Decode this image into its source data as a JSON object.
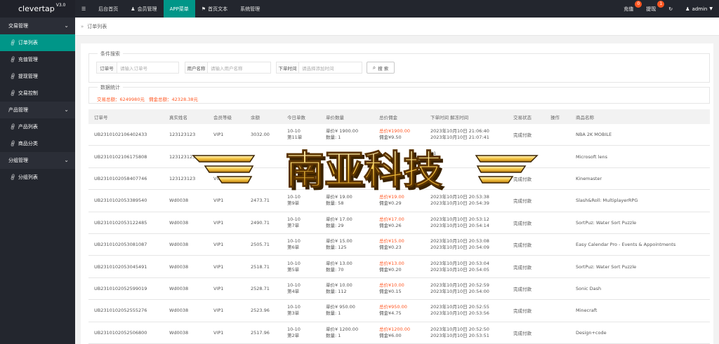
{
  "app": {
    "name": "clevertap",
    "version": "V3.0"
  },
  "topnav": [
    {
      "label": "后台首页",
      "icon": "home-icon",
      "glyph": "⌂"
    },
    {
      "label": "会员管理",
      "icon": "user-icon",
      "glyph": "♟"
    },
    {
      "label": "APP菜单",
      "icon": "",
      "glyph": "",
      "active": true
    },
    {
      "label": "首页文本",
      "icon": "flag-icon",
      "glyph": "⚑"
    },
    {
      "label": "系统管理",
      "icon": "",
      "glyph": ""
    }
  ],
  "topright": {
    "recharge": {
      "label": "充值",
      "badge": "0"
    },
    "withdraw": {
      "label": "提现",
      "badge": "1"
    },
    "refresh_glyph": "↻",
    "user": "admin"
  },
  "sidebar": [
    {
      "type": "group",
      "label": "交易管理"
    },
    {
      "type": "item",
      "label": "订单列表",
      "active": true
    },
    {
      "type": "item",
      "label": "充值管理"
    },
    {
      "type": "item",
      "label": "提现管理"
    },
    {
      "type": "item",
      "label": "交易控制"
    },
    {
      "type": "group",
      "label": "产品管理"
    },
    {
      "type": "item",
      "label": "产品列表"
    },
    {
      "type": "item",
      "label": "商品分类"
    },
    {
      "type": "group",
      "label": "分组管理"
    },
    {
      "type": "item",
      "label": "分组列表"
    }
  ],
  "breadcrumb": "订单列表",
  "search": {
    "legend": "条件搜索",
    "order_label": "订单号",
    "order_placeholder": "请输入订单号",
    "user_label": "用户名称",
    "user_placeholder": "请输入用户名称",
    "time_label": "下单时间",
    "time_placeholder": "请选择添加时间",
    "button": "搜 索"
  },
  "stats": {
    "legend": "数据统计",
    "total_trade": "交易总额：6249980元",
    "total_commission": "佣金总额：42328.38元"
  },
  "table": {
    "headers": [
      "订单号",
      "真实姓名",
      "会员等级",
      "余额",
      "今日单数",
      "单价数量",
      "总价佣金",
      "下单时间 解冻时间",
      "交易状态",
      "操作",
      "商品名称"
    ],
    "rows": [
      {
        "order": "UB2310102106402433",
        "name": "123123123",
        "level": "VIP1",
        "balance": "3032.00",
        "day": "10-10",
        "nth": "第11单",
        "price": "单价¥ 1900.00",
        "qty": "数量: 1",
        "total": "总价¥1900.00",
        "comm": "佣金¥9.50",
        "t1": "2023年10月10日 21:06:40",
        "t2": "2023年10月10日 21:07:41",
        "status": "完成付款",
        "product": "NBA 2K MOBILE"
      },
      {
        "order": "UB2310102106175808",
        "name": "123123123",
        "level": "",
        "balance": "",
        "day": "",
        "nth": "",
        "price": "",
        "qty": "",
        "total": "",
        "comm": "",
        "t1": "21",
        "t2": "21",
        "status": "完成付款",
        "product": "Microsoft lens"
      },
      {
        "order": "UB2310102058407746",
        "name": "123123123",
        "level": "VIP1",
        "balance": "",
        "day": "",
        "nth": "",
        "price": "",
        "qty": "",
        "total": "",
        "comm": "佣金¥10.0",
        "t1": "",
        "t2": ":42",
        "status": "完成付款",
        "product": "Kinemaster"
      },
      {
        "order": "UB2310102053389540",
        "name": "Wd0038",
        "level": "VIP1",
        "balance": "2473.71",
        "day": "10-10",
        "nth": "第9单",
        "price": "单价¥ 19.00",
        "qty": "数量: 58",
        "total": "总价¥19.00",
        "comm": "佣金¥0.29",
        "t1": "2023年10月10日 20:53:38",
        "t2": "2023年10月10日 20:54:39",
        "status": "完成付款",
        "product": "Slash&Roll: MultiplayerRPG"
      },
      {
        "order": "UB2310102053122485",
        "name": "Wd0038",
        "level": "VIP1",
        "balance": "2490.71",
        "day": "10-10",
        "nth": "第7单",
        "price": "单价¥ 17.00",
        "qty": "数量: 29",
        "total": "总价¥17.00",
        "comm": "佣金¥0.26",
        "t1": "2023年10月10日 20:53:12",
        "t2": "2023年10月10日 20:54:14",
        "status": "完成付款",
        "product": "SortPuz: Water Sort Puzzle"
      },
      {
        "order": "UB2310102053081087",
        "name": "Wd0038",
        "level": "VIP1",
        "balance": "2505.71",
        "day": "10-10",
        "nth": "第6单",
        "price": "单价¥ 15.00",
        "qty": "数量: 125",
        "total": "总价¥15.00",
        "comm": "佣金¥0.23",
        "t1": "2023年10月10日 20:53:08",
        "t2": "2023年10月10日 20:54:09",
        "status": "完成付款",
        "product": "Easy Calendar Pro - Events & Appointments"
      },
      {
        "order": "UB2310102053045491",
        "name": "Wd0038",
        "level": "VIP1",
        "balance": "2518.71",
        "day": "10-10",
        "nth": "第5单",
        "price": "单价¥ 13.00",
        "qty": "数量: 70",
        "total": "总价¥13.00",
        "comm": "佣金¥0.20",
        "t1": "2023年10月10日 20:53:04",
        "t2": "2023年10月10日 20:54:05",
        "status": "完成付款",
        "product": "SortPuz: Water Sort Puzzle"
      },
      {
        "order": "UB2310102052599019",
        "name": "Wd0038",
        "level": "VIP1",
        "balance": "2528.71",
        "day": "10-10",
        "nth": "第4单",
        "price": "单价¥ 10.00",
        "qty": "数量: 112",
        "total": "总价¥10.00",
        "comm": "佣金¥0.15",
        "t1": "2023年10月10日 20:52:59",
        "t2": "2023年10月10日 20:54:00",
        "status": "完成付款",
        "product": "Sonic Dash"
      },
      {
        "order": "UB2310102052555276",
        "name": "Wd0038",
        "level": "VIP1",
        "balance": "2523.96",
        "day": "10-10",
        "nth": "第3单",
        "price": "单价¥ 950.00",
        "qty": "数量: 1",
        "total": "总价¥950.00",
        "comm": "佣金¥4.75",
        "t1": "2023年10月10日 20:52:55",
        "t2": "2023年10月10日 20:53:56",
        "status": "完成付款",
        "product": "Minecraft"
      },
      {
        "order": "UB2310102052506800",
        "name": "Wd0038",
        "level": "VIP1",
        "balance": "2517.96",
        "day": "10-10",
        "nth": "第2单",
        "price": "单价¥ 1200.00",
        "qty": "数量: 1",
        "total": "总价¥1200.00",
        "comm": "佣金¥6.00",
        "t1": "2023年10月10日 20:52:50",
        "t2": "2023年10月10日 20:53:51",
        "status": "完成付款",
        "product": "Design+code"
      }
    ]
  },
  "watermark": {
    "text": "南亚科技"
  },
  "colors": {
    "accent": "#009688",
    "dark": "#23262e",
    "red": "#ff5722"
  }
}
